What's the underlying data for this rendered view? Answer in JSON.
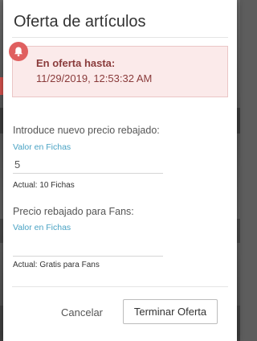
{
  "dialog": {
    "title": "Oferta de artículos",
    "alert": {
      "icon": "bell-icon",
      "title": "En oferta hasta:",
      "value": "11/29/2019, 12:53:32 AM"
    },
    "new_price": {
      "label": "Introduce nuevo precio rebajado:",
      "field_label": "Valor en Fichas",
      "value": "5",
      "current": "Actual: 10 Fichas"
    },
    "fan_price": {
      "label": "Precio rebajado para Fans:",
      "field_label": "Valor en Fichas",
      "value": "",
      "current": "Actual: Gratis para Fans"
    },
    "cancel_label": "Cancelar",
    "end_label": "Terminar Oferta"
  },
  "colors": {
    "alert_text": "#8a3b3b",
    "alert_bg": "#fbeaea",
    "alert_icon": "#e06060",
    "field_label": "#4aa3c4"
  }
}
